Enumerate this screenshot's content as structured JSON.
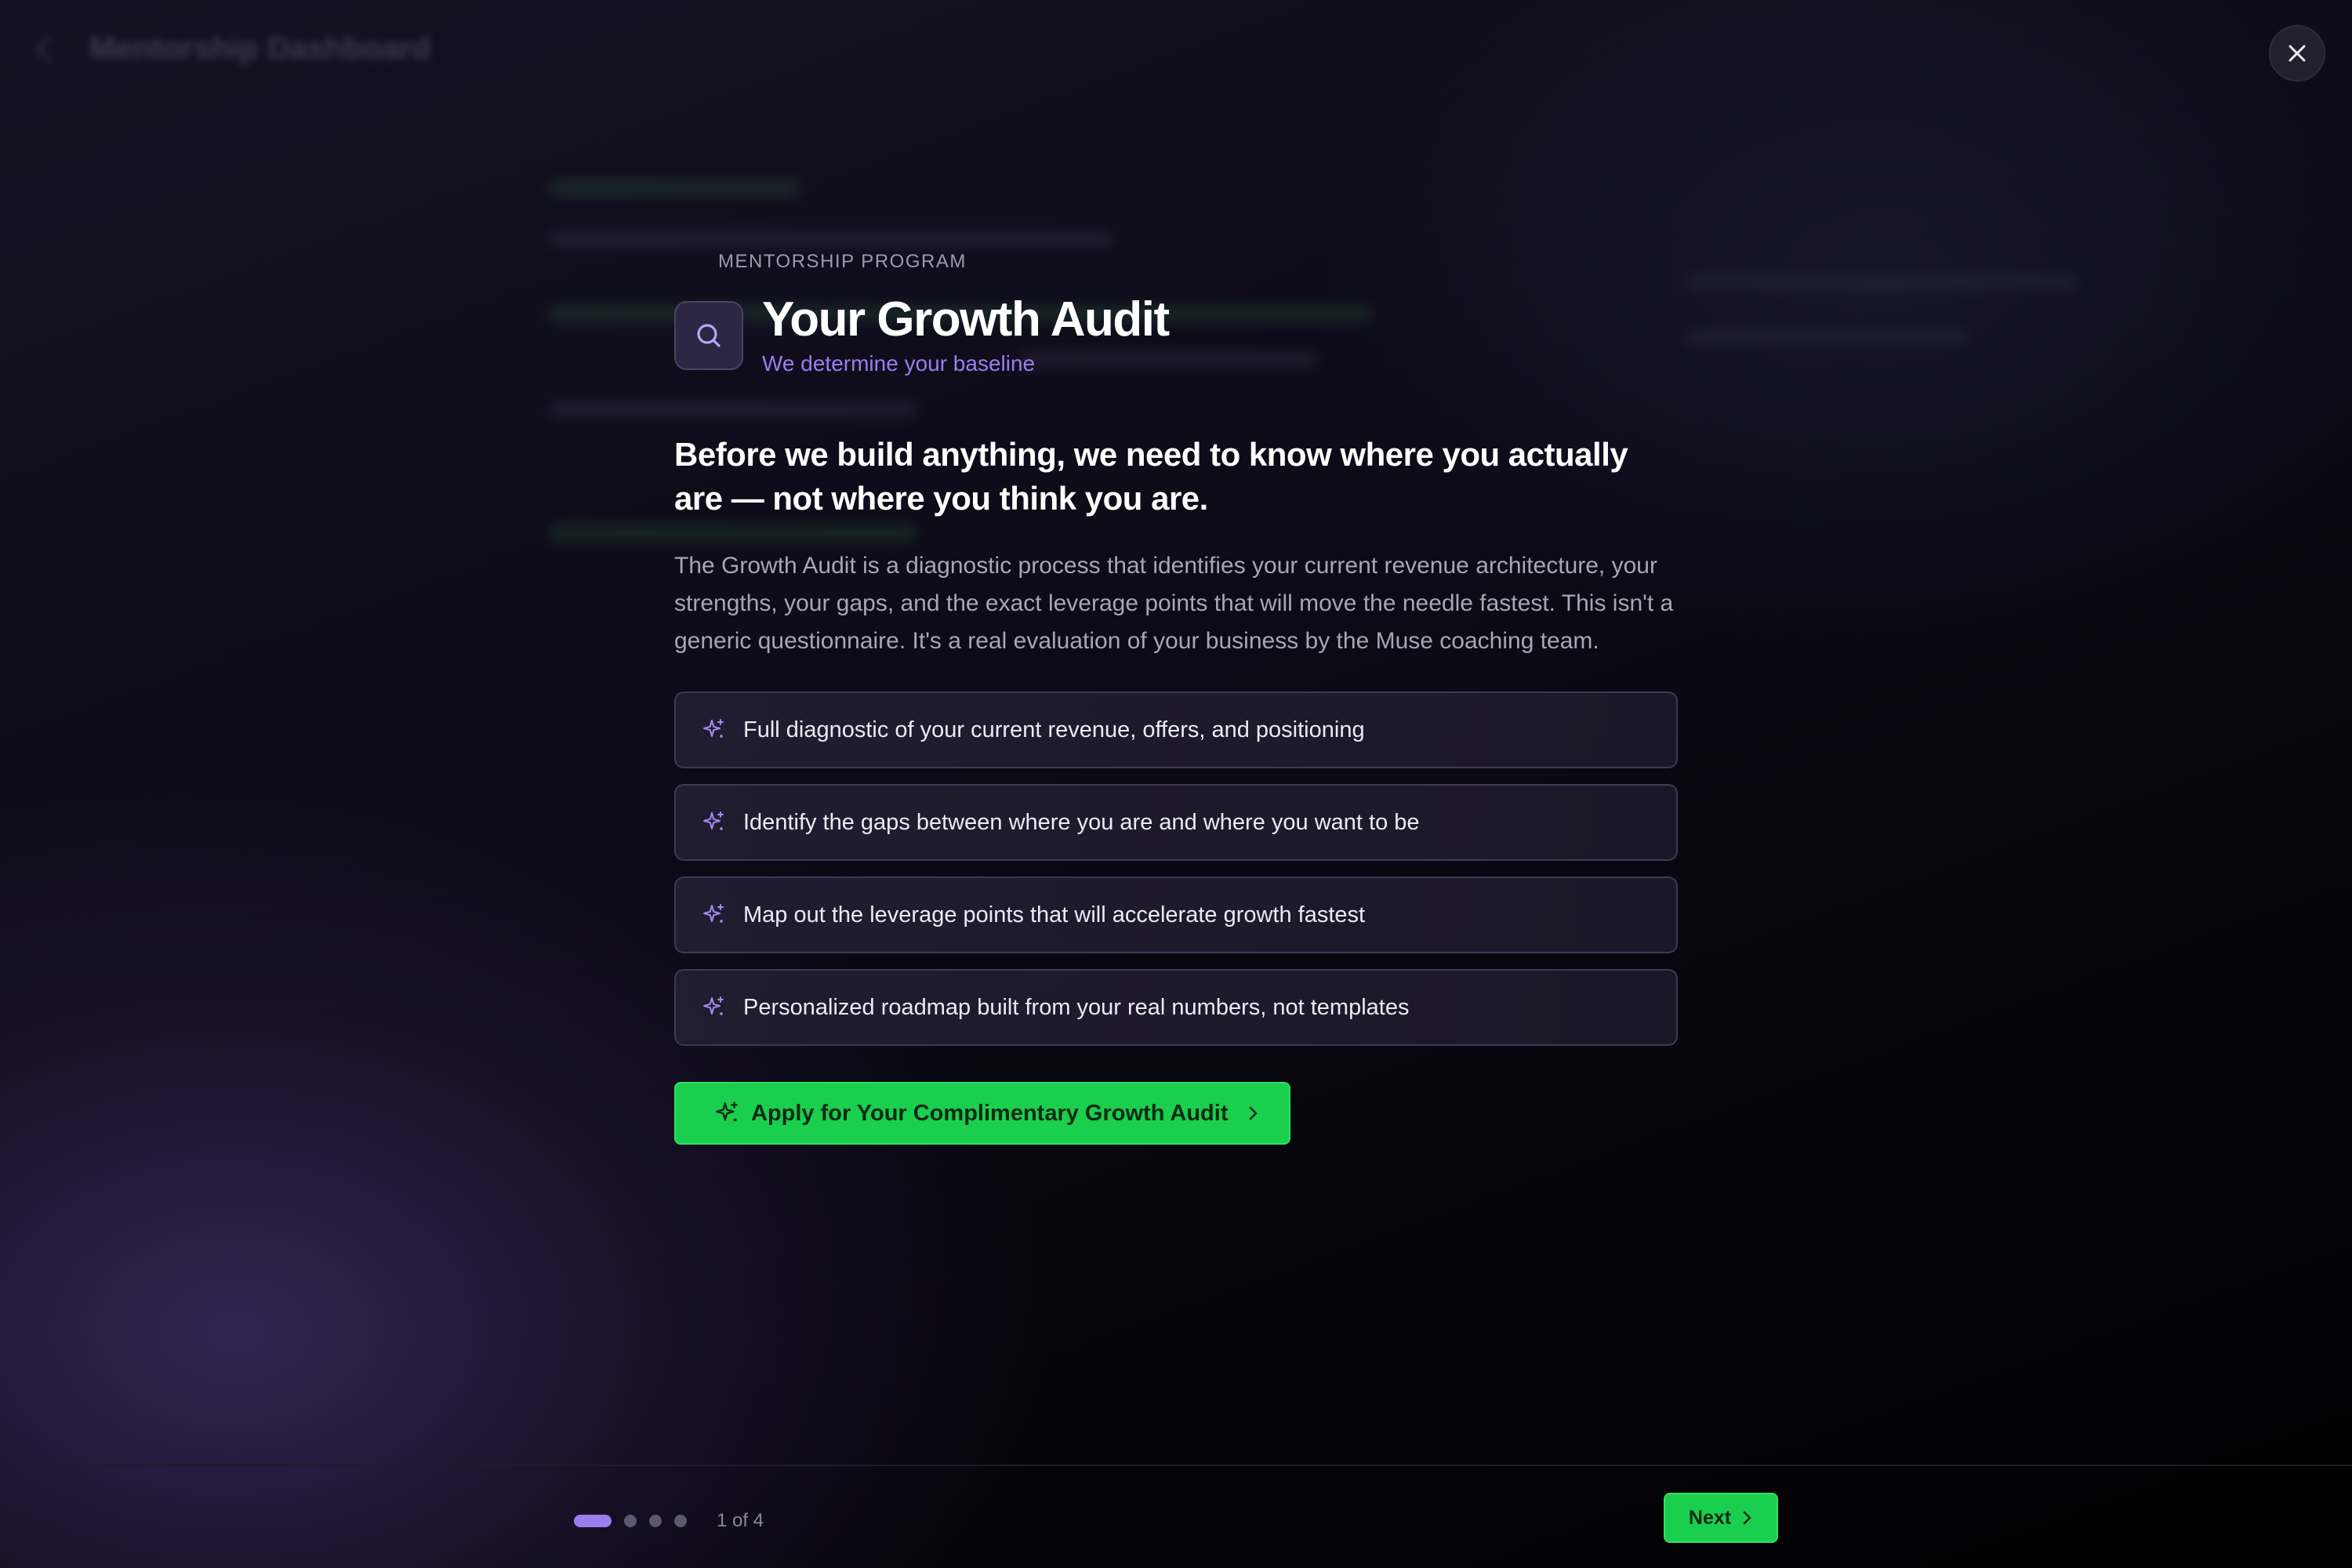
{
  "background": {
    "header_title": "Mentorship Dashboard"
  },
  "modal": {
    "eyebrow": "MENTORSHIP PROGRAM",
    "title": "Your Growth Audit",
    "subtitle": "We determine your baseline",
    "title_icon": "search-icon",
    "headline": "Before we build anything, we need to know where you actually are — not where you think you are.",
    "description": "The Growth Audit is a diagnostic process that identifies your current revenue architecture, your strengths, your gaps, and the exact leverage points that will move the needle fastest. This isn't a generic questionnaire. It's a real evaluation of your business by the Muse coaching team.",
    "features": [
      "Full diagnostic of your current revenue, offers, and positioning",
      "Identify the gaps between where you are and where you want to be",
      "Map out the leverage points that will accelerate growth fastest",
      "Personalized roadmap built from your real numbers, not templates"
    ],
    "feature_icon": "sparkle-icon",
    "cta_label": "Apply for Your Complimentary Growth Audit"
  },
  "footer": {
    "step_current": 1,
    "step_total": 4,
    "pager_text": "1 of 4",
    "next_label": "Next"
  },
  "colors": {
    "accent_purple": "#9b7df0",
    "cta_green": "#1bcf4e"
  }
}
